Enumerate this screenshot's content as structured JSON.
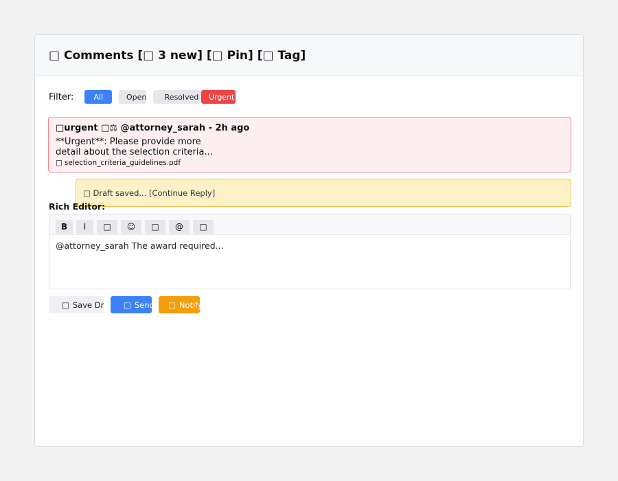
{
  "header": {
    "title": "□ Comments [□ 3 new] [□ Pin] [□ Tag]"
  },
  "filter": {
    "label": "Filter:",
    "options": [
      "All",
      "Open",
      "Resolved",
      "Urgent"
    ],
    "selected": "All"
  },
  "comment": {
    "heading": "□urgent □⚖ @attorney_sarah - 2h ago",
    "body": "**Urgent**: Please provide more detail about the selection criteria...",
    "attachment_icon": "□",
    "attachment_name": "selection_criteria_guidelines.pdf"
  },
  "draft": {
    "text": "□ Draft saved... [Continue Reply]"
  },
  "editor": {
    "label": "Rich Editor:",
    "toolbar": {
      "bold": "B",
      "italic": "I",
      "link": "□",
      "emoji": "☺",
      "attach": "□",
      "mention": "@",
      "more": "□"
    },
    "content": "@attorney_sarah The award required..."
  },
  "actions": {
    "save_icon": "□",
    "save_label": "Save Draft",
    "send_icon": "□",
    "send_label": "Send",
    "notify_icon": "□",
    "notify_label": "Notify"
  },
  "colors": {
    "primary": "#3b82f6",
    "danger": "#ef4444",
    "warning": "#f59e0b",
    "urgent_bg": "#fef0f0",
    "draft_bg": "#fdf1c7"
  }
}
